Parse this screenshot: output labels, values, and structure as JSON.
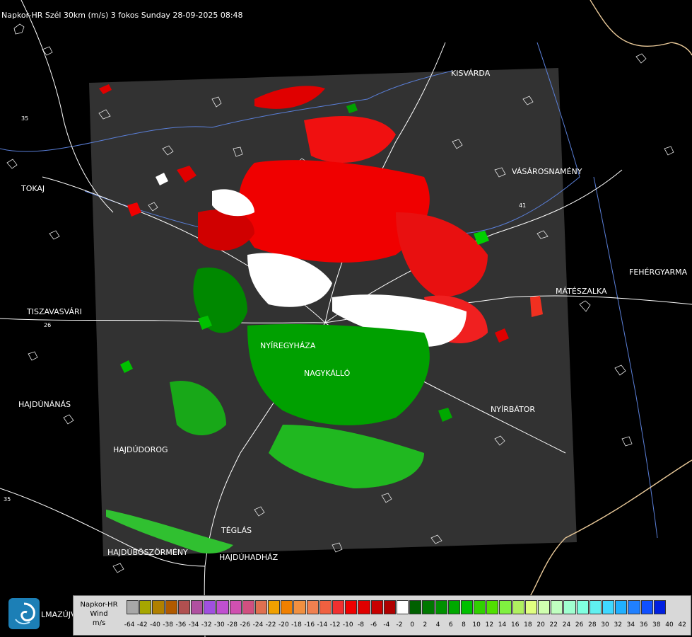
{
  "title": "Napkor-HR Szél 30km (m/s) 3 fokos Sunday 28-09-2025 08:48",
  "cities": [
    {
      "id": "kisvarda",
      "name": "KISVÁRDA"
    },
    {
      "id": "tokaj",
      "name": "TOKAJ"
    },
    {
      "id": "vasarosnameny",
      "name": "VÁSÁROSNAMÉNY"
    },
    {
      "id": "fehergyarmat",
      "name": "FEHÉRGYARMA"
    },
    {
      "id": "mateszalka",
      "name": "MÁTÉSZALKA"
    },
    {
      "id": "tiszavasvari",
      "name": "TISZAVASVÁRI"
    },
    {
      "id": "nyiregyhaza",
      "name": "NYÍREGYHÁZA"
    },
    {
      "id": "nagykallo",
      "name": "NAGYKÁLLÓ"
    },
    {
      "id": "hajdunanas",
      "name": "HAJDÚNÁNÁS"
    },
    {
      "id": "nyirbator",
      "name": "NYÍRBÁTOR"
    },
    {
      "id": "hajdudorog",
      "name": "HAJDÚDOROG"
    },
    {
      "id": "teglas",
      "name": "TÉGLÁS"
    },
    {
      "id": "hajduboszormeny",
      "name": "HAJDÚBÖSZÖRMÉNY"
    },
    {
      "id": "hajduhadhaz",
      "name": "HAJDÚHADHÁZ"
    },
    {
      "id": "balmazujvaros",
      "name": "LMAZÚJVÁR"
    }
  ],
  "road_numbers": [
    "35",
    "26",
    "41",
    "35"
  ],
  "legend": {
    "line1": "Napkor-HR",
    "line2": "Wind",
    "line3": "m/s",
    "colors": [
      "#a8a8a8",
      "#a6a600",
      "#b08000",
      "#b05a00",
      "#b05050",
      "#b050a0",
      "#a050e0",
      "#c050d0",
      "#d050b0",
      "#d05080",
      "#e07050",
      "#f0a000",
      "#f08000",
      "#f09040",
      "#f08050",
      "#f06040",
      "#f03030",
      "#f00000",
      "#e00000",
      "#c80000",
      "#b00000",
      "#ffffff",
      "#006000",
      "#007800",
      "#009000",
      "#00a800",
      "#00c000",
      "#30d000",
      "#50e000",
      "#80f040",
      "#b0f060",
      "#e0ff80",
      "#d0ffb0",
      "#c0ffc0",
      "#a0ffd0",
      "#80ffe0",
      "#60f0f0",
      "#40d8ff",
      "#20b0ff",
      "#2080ff",
      "#1050ff",
      "#0020e0"
    ],
    "labels": [
      "-64",
      "-42",
      "-40",
      "-38",
      "-36",
      "-34",
      "-32",
      "-30",
      "-28",
      "-26",
      "-24",
      "-22",
      "-20",
      "-18",
      "-16",
      "-14",
      "-12",
      "-10",
      "-8",
      "-6",
      "-4",
      "-2",
      "0",
      "2",
      "4",
      "6",
      "8",
      "10",
      "12",
      "14",
      "16",
      "18",
      "20",
      "22",
      "24",
      "26",
      "28",
      "30",
      "32",
      "34",
      "36",
      "38",
      "40",
      "42"
    ]
  }
}
